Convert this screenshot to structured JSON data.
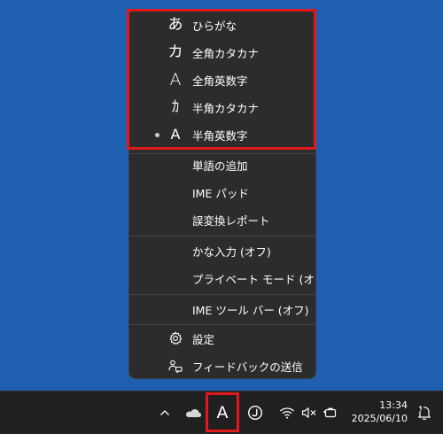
{
  "menu": {
    "input_modes": [
      {
        "glyph": "あ",
        "label": "ひらがな",
        "selected": false
      },
      {
        "glyph": "カ",
        "label": "全角カタカナ",
        "selected": false
      },
      {
        "glyph": "A",
        "label": "全角英数字",
        "selected": false
      },
      {
        "glyph": "ｶ",
        "label": "半角カタカナ",
        "selected": false
      },
      {
        "glyph": "A",
        "label": "半角英数字",
        "selected": true
      }
    ],
    "tools": [
      {
        "label": "単語の追加"
      },
      {
        "label": "IME パッド"
      },
      {
        "label": "誤変換レポート"
      }
    ],
    "options": [
      {
        "label": "かな入力 (オフ)"
      },
      {
        "label": "プライベート モード (オフ)"
      }
    ],
    "toolbar": {
      "label": "IME ツール バー (オフ)"
    },
    "settings": {
      "label": "設定",
      "icon": "gear-icon"
    },
    "feedback": {
      "label": "フィードバックの送信",
      "icon": "feedback-icon"
    }
  },
  "taskbar": {
    "ime_indicator": "A",
    "clock_time": "13:34",
    "clock_date": "2025/06/10"
  },
  "colors": {
    "desktop": "#1e5fb0",
    "menu_bg": "#2c2c2c",
    "taskbar_bg": "#202020",
    "highlight": "#e0181b"
  }
}
